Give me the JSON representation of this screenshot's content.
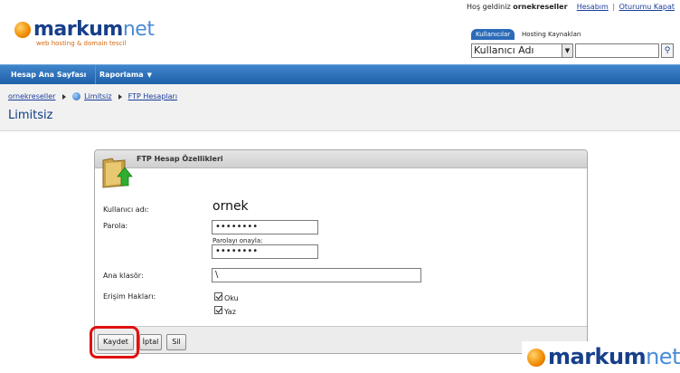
{
  "brand": {
    "logo_bold": "markum",
    "logo_thin": "net",
    "tagline": "web hosting & domain tescil"
  },
  "topbar": {
    "greeting": "Hoş geldiniz",
    "username": "ornekreseller",
    "account_link": "Hesabım",
    "separator": "|",
    "logout_link": "Oturumu Kapat"
  },
  "search": {
    "tab_users": "Kullanıcılar",
    "tab_hosting": "Hosting Kaynakları",
    "select_value": "Kullanıcı Adı",
    "query": ""
  },
  "nav": {
    "home": "Hesap Ana Sayfası",
    "reports": "Raporlama"
  },
  "breadcrumb": {
    "item1": "ornekreseller",
    "item2": "Limitsiz",
    "item3": "FTP Hesapları"
  },
  "page_title": "Limitsiz",
  "panel": {
    "title": "FTP Hesap Özellikleri",
    "username_label": "Kullanıcı adı:",
    "username_value": "ornek",
    "password_label": "Parola:",
    "password_value": "••••••••",
    "confirm_label": "Parolayı onayla:",
    "confirm_value": "••••••••",
    "folder_label": "Ana klasör:",
    "folder_value": "\\",
    "rights_label": "Erişim Hakları:",
    "read_label": "Oku",
    "write_label": "Yaz"
  },
  "buttons": {
    "save": "Kaydet",
    "cancel": "İptal",
    "delete": "Sil"
  },
  "colors": {
    "nav_blue": "#1f5fa8",
    "title_blue": "#0e3b86",
    "highlight_red": "#e01010"
  }
}
